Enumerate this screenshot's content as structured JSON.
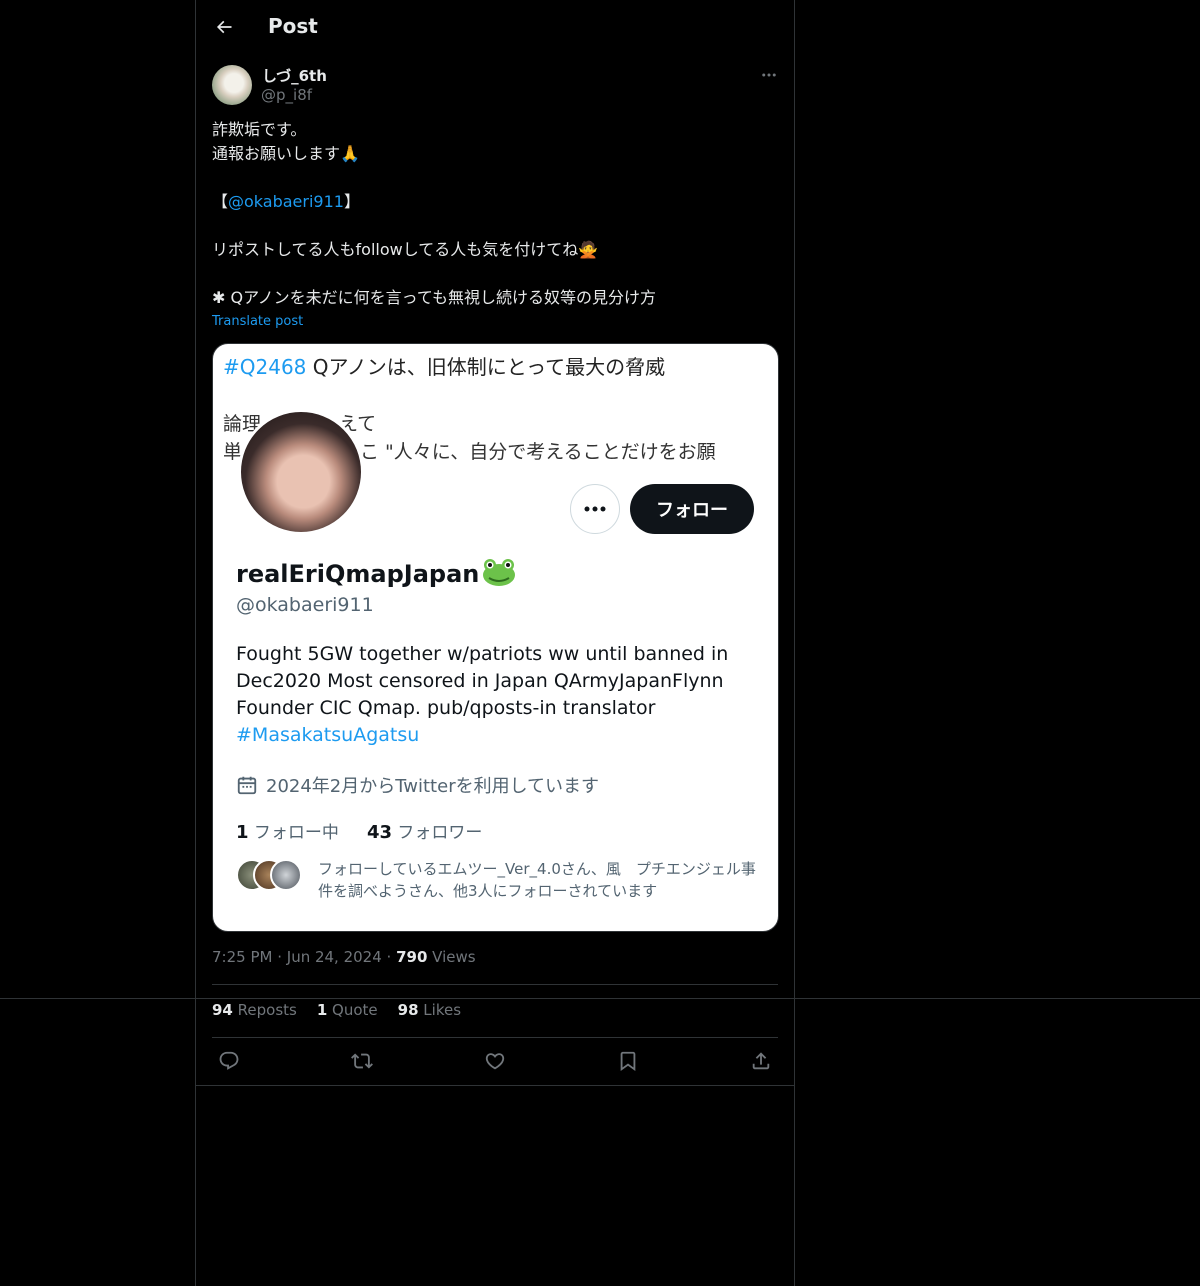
{
  "header": {
    "title": "Post"
  },
  "author": {
    "display_name": "しづ_6th",
    "handle": "@p_i8f"
  },
  "tweet": {
    "line1": "詐欺垢です。",
    "line2": "通報お願いします🙏",
    "mention_open": "【",
    "mention": "@okabaeri911",
    "mention_close": "】",
    "line4": "リポストしてる人もfollowしてる人も気を付けてね🙅",
    "line5": "✱ Qアノンを未だに何を言っても無視し続ける奴等の見分け方",
    "translate_label": "Translate post"
  },
  "media": {
    "hashtag": "#Q2468",
    "headline": " Qアノンは、旧体制にとって最大の脅威",
    "line2": "論理",
    "line2b": "えて",
    "line3": "単",
    "line3b": "こ \"人々に、自分で考えることだけをお願",
    "follow_label": "フォロー",
    "profile_name": "realEriQmapJapan",
    "profile_handle": "@okabaeri911",
    "bio": "Fought 5GW together w/patriots ww until banned in\nDec2020 Most censored in Japan QArmyJapanFlynn\nFounder CIC Qmap. pub/qposts-in translator\n",
    "bio_tag": "#MasakatsuAgatsu",
    "joined": "2024年2月からTwitterを利用しています",
    "following_count": "1",
    "following_label": " フォロー中",
    "followers_count": "43",
    "followers_label": " フォロワー",
    "followed_by": "フォローしているエムツー_Ver_4.0さん、風　プチエンジェル事件を調べようさん、他3人にフォローされています"
  },
  "meta": {
    "time": "7:25 PM",
    "sep": " · ",
    "date": "Jun 24, 2024",
    "views_count": "790",
    "views_label": " Views"
  },
  "stats": {
    "reposts_count": "94",
    "reposts_label": " Reposts",
    "quotes_count": "1",
    "quotes_label": " Quote",
    "likes_count": "98",
    "likes_label": " Likes"
  },
  "colors": {
    "accent": "#1d9bf0",
    "background": "#000000",
    "border": "#2f3336",
    "muted": "#71767b"
  }
}
